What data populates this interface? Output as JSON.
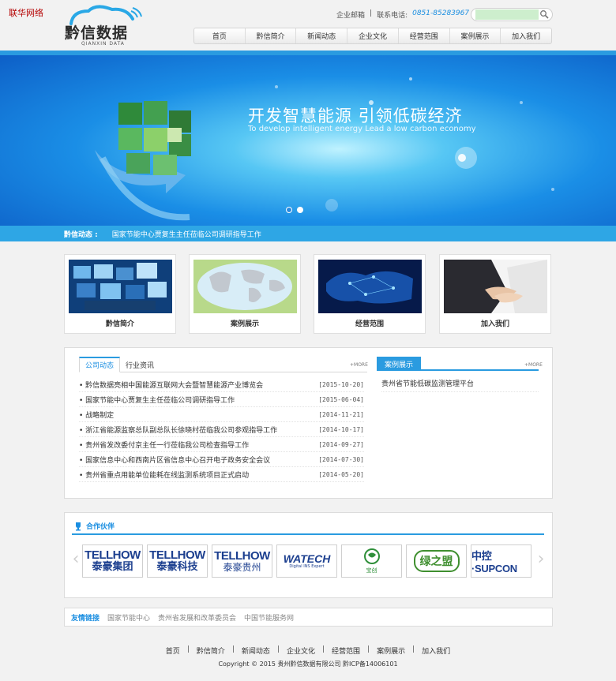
{
  "corner_tag": "联华网络",
  "brand": {
    "name": "黔信数据",
    "sub": "QIANXIN DATA"
  },
  "header": {
    "mailbox": "企业邮箱",
    "divider": "|",
    "phone_label": "联系电话:",
    "phone": "0851-85283967"
  },
  "search": {
    "placeholder": "",
    "icon": "search-icon"
  },
  "nav": [
    {
      "label": "首页"
    },
    {
      "label": "黔信简介"
    },
    {
      "label": "新闻动态"
    },
    {
      "label": "企业文化"
    },
    {
      "label": "经营范围"
    },
    {
      "label": "案例展示"
    },
    {
      "label": "加入我们"
    }
  ],
  "banner": {
    "title": "开发智慧能源 引领低碳经济",
    "subtitle": "To develop intelligent energy Lead a low carbon economy",
    "dots": [
      {
        "active": true
      },
      {
        "active": false
      }
    ]
  },
  "ticker": {
    "label": "黔信动态 :",
    "text": "国家节能中心贾复生主任莅临公司调研指导工作"
  },
  "features": [
    {
      "caption": "黔信简介"
    },
    {
      "caption": "案例展示"
    },
    {
      "caption": "经营范围"
    },
    {
      "caption": "加入我们"
    }
  ],
  "news": {
    "tabs": [
      {
        "label": "公司动态"
      },
      {
        "label": "行业资讯"
      }
    ],
    "more": "+MORE",
    "items": [
      {
        "title": "黔信数据亮相中国能源互联网大会暨智慧能源产业博览会",
        "date": "[2015-10-20]"
      },
      {
        "title": "国家节能中心贾复生主任莅临公司调研指导工作",
        "date": "[2015-06-04]"
      },
      {
        "title": "战略制定",
        "date": "[2014-11-21]"
      },
      {
        "title": "浙江省能源监察总队副总队长徐晓村莅临我公司参观指导工作",
        "date": "[2014-10-17]"
      },
      {
        "title": "贵州省发改委付京主任一行莅临我公司检查指导工作",
        "date": "[2014-09-27]"
      },
      {
        "title": "国家信息中心和西南片区省信息中心召开电子政务安全会议",
        "date": "[2014-07-30]"
      },
      {
        "title": "贵州省重点用能单位能耗在线监测系统项目正式启动",
        "date": "[2014-05-20]"
      }
    ]
  },
  "cases": {
    "title": "案例展示",
    "more": "+MORE",
    "items": [
      {
        "title": "贵州省节能低碳监测管理平台"
      }
    ]
  },
  "partners": {
    "title": "合作伙伴",
    "logos": [
      {
        "top": "TELLHOW",
        "bottom": "泰豪集团",
        "color": "#1c3f8f"
      },
      {
        "top": "TELLHOW",
        "bottom": "泰豪科技",
        "color": "#1c3f8f"
      },
      {
        "top": "TELLHOW",
        "bottom": "泰豪贵州",
        "color": "#1c3f8f"
      },
      {
        "top": "WATECH",
        "bottom": "Digital INS Expert",
        "color": "#1c3f8f"
      },
      {
        "top": "宝创",
        "bottom": "",
        "color": "#2f8f3a"
      },
      {
        "top": "绿之盟",
        "bottom": "",
        "color": "#3f8f2f"
      },
      {
        "top": "中控·SUPCON",
        "bottom": "",
        "color": "#1c3f8f"
      }
    ]
  },
  "links": {
    "title": "友情链接",
    "items": [
      {
        "label": "国家节能中心"
      },
      {
        "label": "贵州省发展和改革委员会"
      },
      {
        "label": "中国节能服务网"
      }
    ]
  },
  "footer": {
    "nav": [
      {
        "label": "首页"
      },
      {
        "label": "黔信简介"
      },
      {
        "label": "新闻动态"
      },
      {
        "label": "企业文化"
      },
      {
        "label": "经营范围"
      },
      {
        "label": "案例展示"
      },
      {
        "label": "加入我们"
      }
    ],
    "separator": "|",
    "copyright": "Copyright © 2015 贵州黔信数据有限公司 黔ICP备14006101"
  },
  "colors": {
    "accent": "#2a9be0",
    "brand_red": "#b40000",
    "link_blue": "#1a8ee1"
  }
}
